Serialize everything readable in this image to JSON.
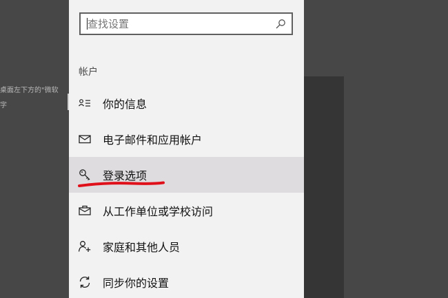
{
  "background": {
    "text_line1": "桌面左下方的\"微软",
    "text_line2": "字"
  },
  "search": {
    "placeholder": "查找设置",
    "icon": "search-icon"
  },
  "section": {
    "header": "帐户"
  },
  "nav": {
    "items": [
      {
        "label": "你的信息",
        "icon": "user-info-icon",
        "selected": false
      },
      {
        "label": "电子邮件和应用帐户",
        "icon": "mail-icon",
        "selected": false
      },
      {
        "label": "登录选项",
        "icon": "key-icon",
        "selected": true
      },
      {
        "label": "从工作单位或学校访问",
        "icon": "briefcase-icon",
        "selected": false
      },
      {
        "label": "家庭和其他人员",
        "icon": "add-person-icon",
        "selected": false
      },
      {
        "label": "同步你的设置",
        "icon": "sync-icon",
        "selected": false
      }
    ]
  },
  "colors": {
    "panel_bg": "#f2f2f2",
    "selected_bg": "#dedcdf",
    "annotation_red": "#e0101a"
  }
}
